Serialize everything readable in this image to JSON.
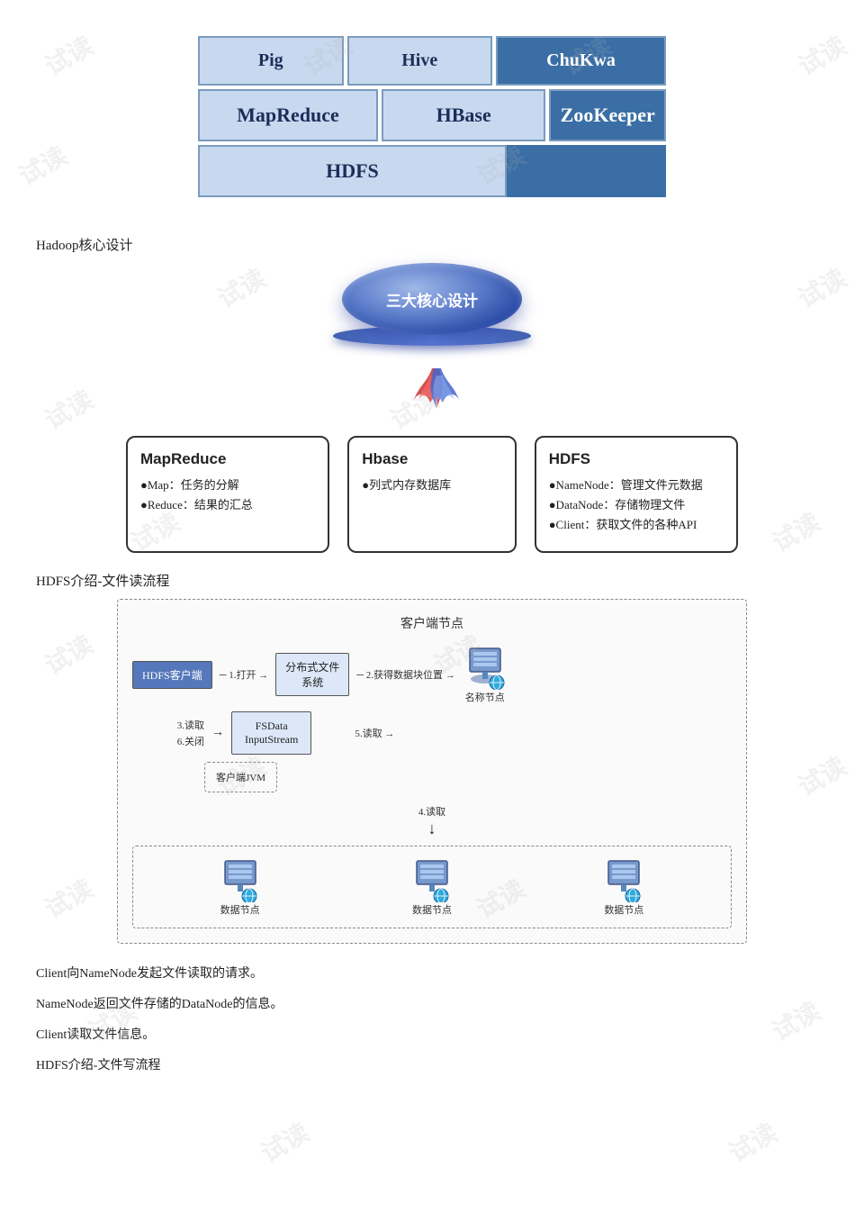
{
  "watermarks": [
    "试读",
    "试读",
    "试读",
    "试读",
    "试读",
    "试读",
    "试读",
    "试读",
    "试读",
    "试读",
    "试读",
    "试读"
  ],
  "hadoop_diagram": {
    "row1": [
      {
        "label": "Pig",
        "class": "pig"
      },
      {
        "label": "Hive",
        "class": "hive"
      },
      {
        "label": "ChuKwa",
        "class": "chukwa dark"
      }
    ],
    "row2": [
      {
        "label": "MapReduce",
        "class": "mapreduce"
      },
      {
        "label": "HBase",
        "class": "hbase"
      },
      {
        "label": "ZooKeeper",
        "class": "zookeeper dark"
      }
    ],
    "row3": [
      {
        "label": "HDFS",
        "class": "hdfs"
      },
      {
        "label": "",
        "class": "hdfs-spacer dark"
      }
    ]
  },
  "section1_label": "Hadoop核心设计",
  "core_design": {
    "globe_text": "三大核心设计",
    "boxes": [
      {
        "title": "MapReduce",
        "content": "●Map：任务的分解\n●Reduce：结果的汇总"
      },
      {
        "title": "Hbase",
        "content": "●列式内存数据库"
      },
      {
        "title": "HDFS",
        "content": "●NameNode：管理文件元数据\n●DataNode：存储物理文件\n●Client：获取文件的各种API"
      }
    ]
  },
  "section2_label": "HDFS介绍-文件读流程",
  "hdfs_read": {
    "client_area_label": "客户端节点",
    "hdfs_client": "HDFS客户端",
    "step1": "1.打开→",
    "distributed_fs": "分布式文件\n系统",
    "step2": "2.获得数据块位置→",
    "namenode_label": "名称节点",
    "step3_6": "3.读取\n6.关闭",
    "fsdata": "FSData\nInputStream",
    "client_jvm": "客户端JVM",
    "step5": "5.读取→",
    "step4": "4.读取",
    "datanodes": [
      "数据节点",
      "数据节点",
      "数据节点"
    ]
  },
  "descriptions": [
    "Client向NameNode发起文件读取的请求。",
    "NameNode返回文件存储的DataNode的信息。",
    "Client读取文件信息。",
    "HDFS介绍-文件写流程"
  ]
}
